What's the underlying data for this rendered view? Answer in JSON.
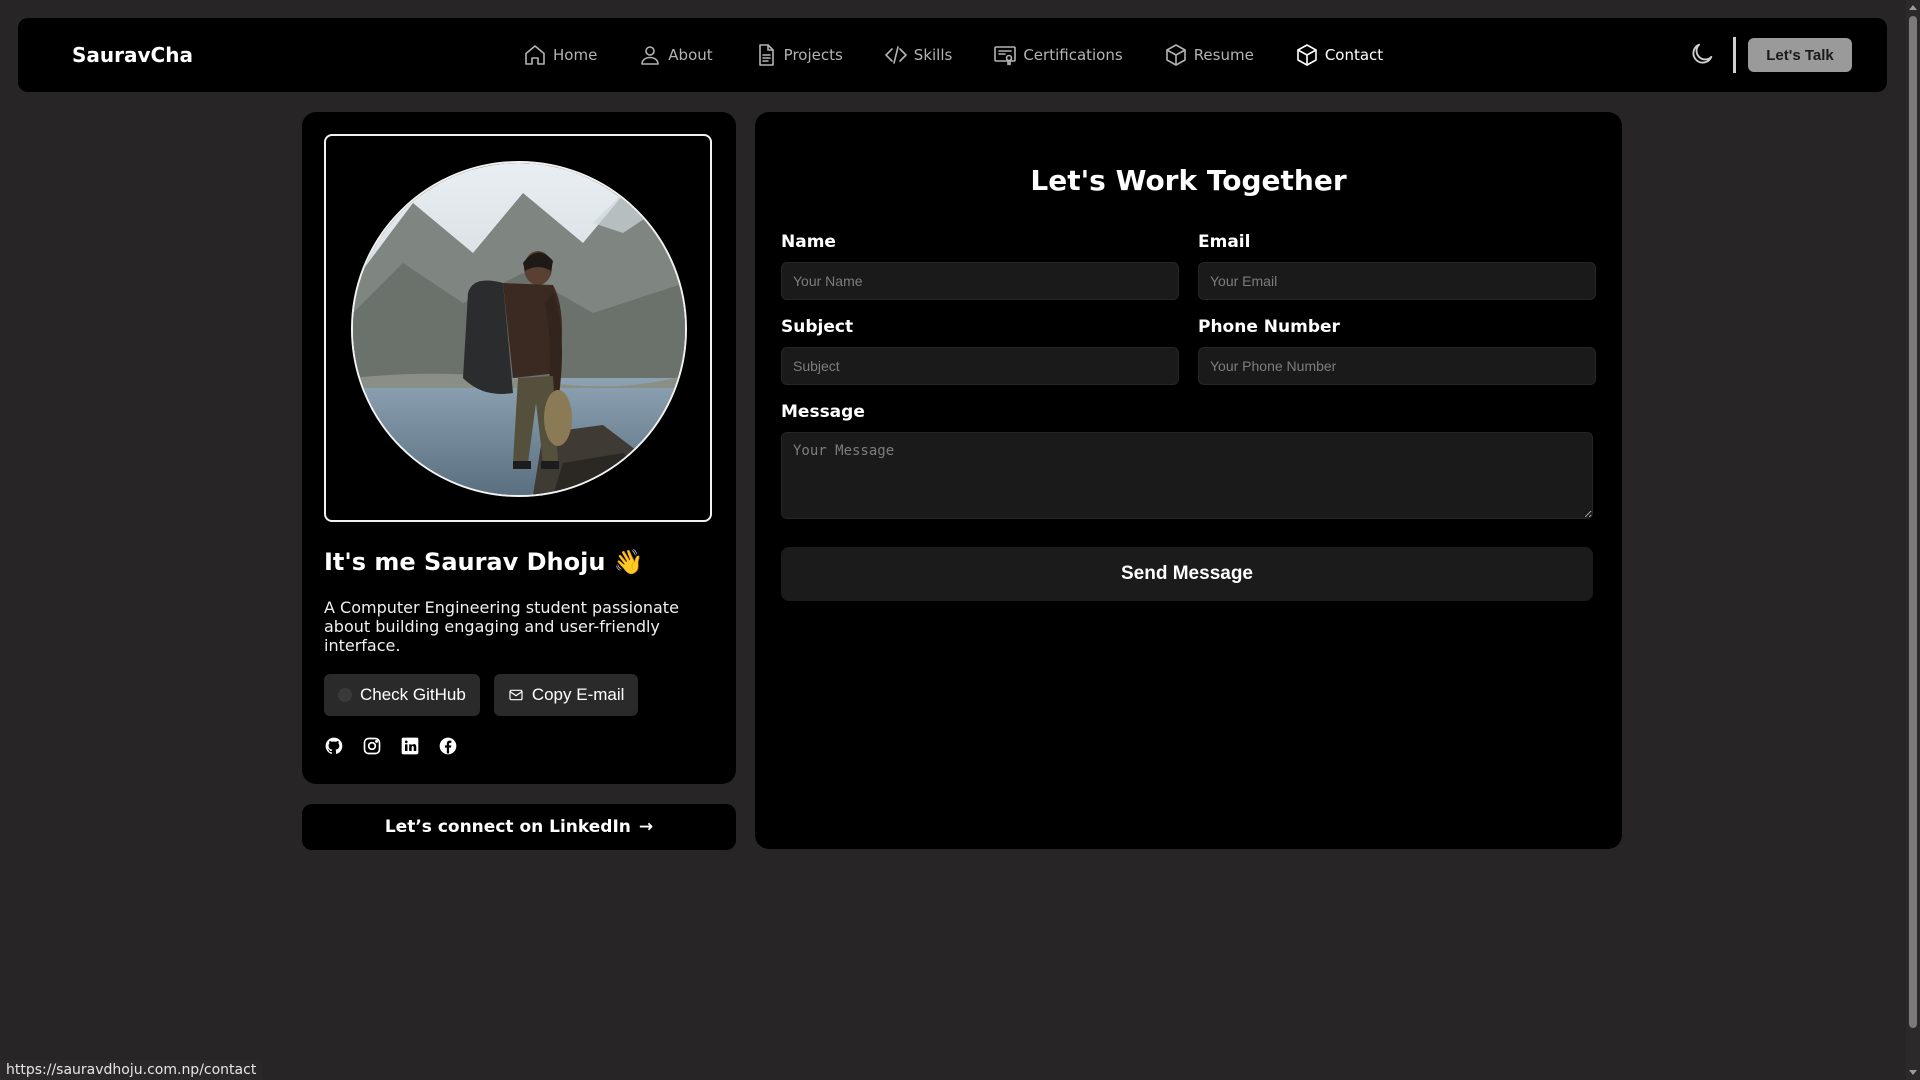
{
  "nav": {
    "brand": "SauravCha",
    "links": [
      {
        "label": "Home",
        "icon": "home-icon"
      },
      {
        "label": "About",
        "icon": "user-icon"
      },
      {
        "label": "Projects",
        "icon": "file-icon"
      },
      {
        "label": "Skills",
        "icon": "code-icon"
      },
      {
        "label": "Certifications",
        "icon": "certificate-icon"
      },
      {
        "label": "Resume",
        "icon": "box-icon"
      },
      {
        "label": "Contact",
        "icon": "cube-icon",
        "active": true
      }
    ],
    "cta_label": "Let's Talk",
    "theme_icon": "moon-icon"
  },
  "profile": {
    "title": "It's me Saurav Dhoju",
    "wave": "👋",
    "description": "A Computer Engineering student passionate about building engaging and user-friendly interface.",
    "github_button": "Check GitHub",
    "email_button": "Copy E-mail",
    "socials": [
      "github-icon",
      "instagram-icon",
      "linkedin-icon",
      "facebook-icon"
    ],
    "linkedin_cta": "Let’s connect on LinkedIn",
    "linkedin_arrow": "→"
  },
  "form": {
    "title": "Let's Work Together",
    "name_label": "Name",
    "name_placeholder": "Your Name",
    "email_label": "Email",
    "email_placeholder": "Your Email",
    "subject_label": "Subject",
    "subject_placeholder": "Subject",
    "phone_label": "Phone Number",
    "phone_placeholder": "Your Phone Number",
    "message_label": "Message",
    "message_placeholder": "Your Message",
    "send_label": "Send Message"
  },
  "status_bar": {
    "url": "https://sauravdhoju.com.np/contact"
  },
  "colors": {
    "background": "#272525",
    "card": "#000000",
    "input": "#1a1a1a",
    "talk_button": "#9a9a9a"
  }
}
